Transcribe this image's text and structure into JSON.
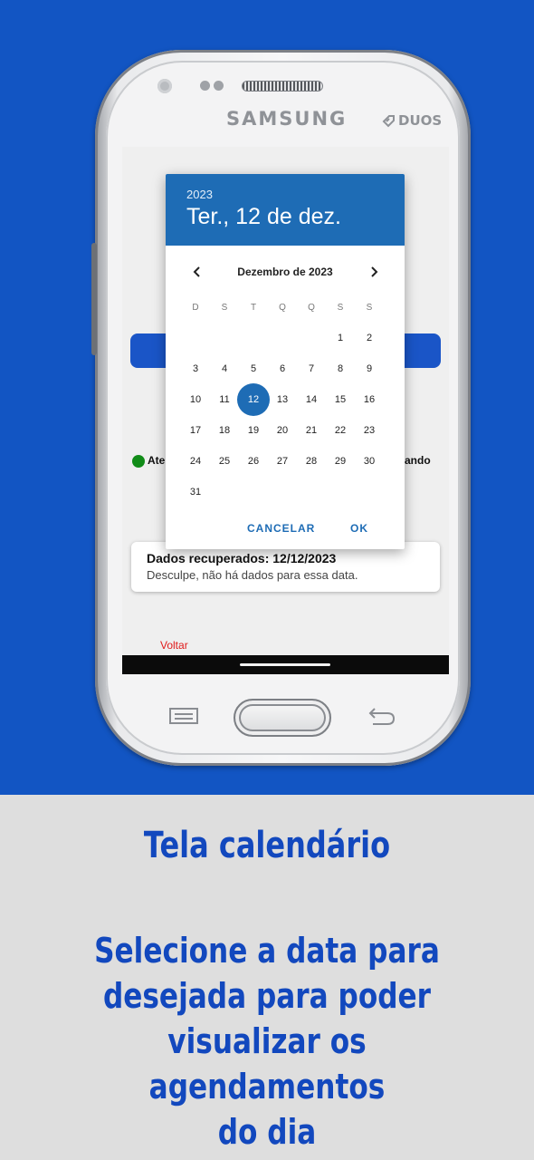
{
  "phone": {
    "brand": "SAMSUNG",
    "model_badge": "DUOS"
  },
  "screen": {
    "legend": {
      "left_label": "Ate",
      "right_label": "rdando",
      "dot_color": "#118c18"
    },
    "result": {
      "title": "Dados recuperados: 12/12/2023",
      "message": "Desculpe, não há dados para essa data."
    },
    "back_label": "Voltar"
  },
  "date_picker": {
    "year": "2023",
    "selected_date_label": "Ter., 12 de dez.",
    "month_label": "Dezembro de 2023",
    "weekdays": [
      "D",
      "S",
      "T",
      "Q",
      "Q",
      "S",
      "S"
    ],
    "first_weekday_index": 5,
    "days_in_month": 31,
    "selected_day": 12,
    "cancel_label": "CANCELAR",
    "ok_label": "OK",
    "accent_color": "#1e6cb5",
    "icons": {
      "prev": "chevron-left-icon",
      "next": "chevron-right-icon"
    }
  },
  "caption": {
    "title": "Tela calendário",
    "lines": [
      "Selecione a data para",
      "desejada para poder",
      "visualizar os agendamentos",
      "do dia"
    ]
  },
  "colors": {
    "background_top": "#1255c3",
    "caption_text": "#1248be",
    "page_bottom": "#dedede"
  }
}
